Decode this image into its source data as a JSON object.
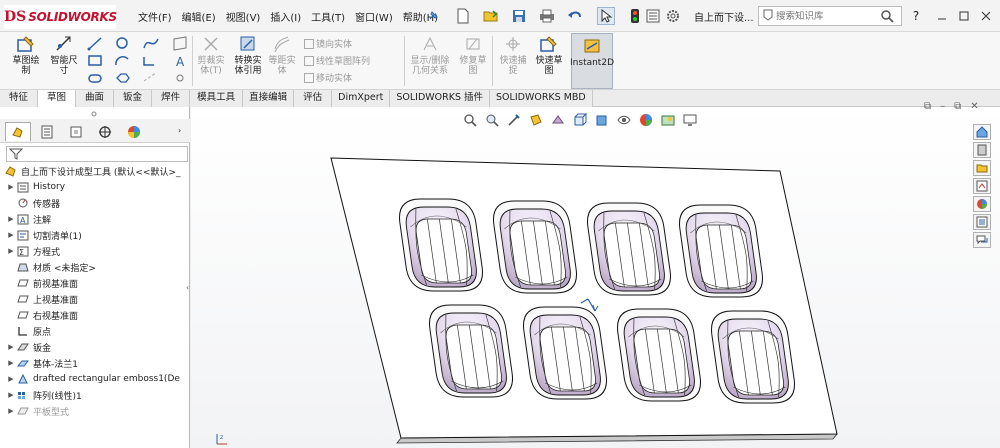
{
  "app": {
    "logo_ds": "DS",
    "logo_text": "SOLIDWORKS",
    "doc_title": "自上而下设...",
    "search_placeholder": "搜索知识库"
  },
  "menu": [
    "文件(F)",
    "编辑(E)",
    "视图(V)",
    "插入(I)",
    "工具(T)",
    "窗口(W)",
    "帮助(H)"
  ],
  "quick_access": [
    "new-icon",
    "open-icon",
    "save-icon",
    "print-icon",
    "undo-icon",
    "select-icon",
    "rebuild-icon",
    "file-properties-icon",
    "options-icon"
  ],
  "window_controls": [
    "help-icon",
    "minimize-icon",
    "restore-icon",
    "close-icon"
  ],
  "ribbon": {
    "sketch": "草图绘\n制",
    "smart_dim": "智能尺\n寸",
    "trim": "剪裁实\n体(T)",
    "convert": "转换实\n体引用",
    "offset": "等距实\n体",
    "mirror": "镜向实体",
    "linear_pattern": "线性草图阵列",
    "move": "移动实体",
    "display_relations": "显示/删除\n几何关系",
    "repair": "修复草\n图",
    "quick_snap": "快速捕\n捉",
    "rapid_sketch": "快速草\n图",
    "instant2d": "Instant2D"
  },
  "tabs": [
    "特征",
    "草图",
    "曲面",
    "钣金",
    "焊件",
    "模具工具",
    "直接编辑",
    "评估",
    "DimXpert",
    "SOLIDWORKS 插件",
    "SOLIDWORKS MBD"
  ],
  "active_tab": "草图",
  "feature_tree": {
    "root": "自上而下设计成型工具 (默认<<默认>_",
    "items": [
      {
        "label": "History",
        "icon": "history-icon",
        "expand": true
      },
      {
        "label": "传感器",
        "icon": "sensor-icon",
        "expand": false
      },
      {
        "label": "注解",
        "icon": "annotation-icon",
        "expand": true
      },
      {
        "label": "切割清单(1)",
        "icon": "cut-list-icon",
        "expand": true
      },
      {
        "label": "方程式",
        "icon": "equation-icon",
        "expand": true
      },
      {
        "label": "材质 <未指定>",
        "icon": "material-icon",
        "expand": false
      },
      {
        "label": "前视基准面",
        "icon": "plane-icon",
        "expand": false
      },
      {
        "label": "上视基准面",
        "icon": "plane-icon",
        "expand": false
      },
      {
        "label": "右视基准面",
        "icon": "plane-icon",
        "expand": false
      },
      {
        "label": "原点",
        "icon": "origin-icon",
        "expand": false
      },
      {
        "label": "钣金",
        "icon": "sheet-metal-icon",
        "expand": true
      },
      {
        "label": "基体-法兰1",
        "icon": "base-flange-icon",
        "expand": true
      },
      {
        "label": "drafted rectangular emboss1(De",
        "icon": "form-tool-icon",
        "expand": true
      },
      {
        "label": "阵列(线性)1",
        "icon": "linear-pattern-icon",
        "expand": true
      },
      {
        "label": "平板型式",
        "icon": "flat-pattern-icon",
        "expand": true,
        "grey": true
      }
    ]
  },
  "colors": {
    "brand": "#c8102e",
    "tab_active": "#ffffff",
    "instant2d_bg": "#d9dde2"
  }
}
